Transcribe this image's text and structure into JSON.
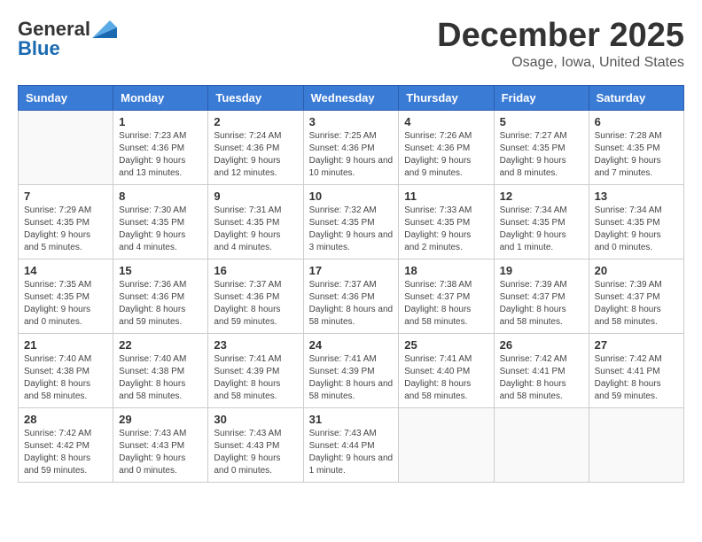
{
  "logo": {
    "general": "General",
    "blue": "Blue"
  },
  "header": {
    "month": "December 2025",
    "location": "Osage, Iowa, United States"
  },
  "days_of_week": [
    "Sunday",
    "Monday",
    "Tuesday",
    "Wednesday",
    "Thursday",
    "Friday",
    "Saturday"
  ],
  "weeks": [
    [
      {
        "day": "",
        "info": ""
      },
      {
        "day": "1",
        "info": "Sunrise: 7:23 AM\nSunset: 4:36 PM\nDaylight: 9 hours and 13 minutes."
      },
      {
        "day": "2",
        "info": "Sunrise: 7:24 AM\nSunset: 4:36 PM\nDaylight: 9 hours and 12 minutes."
      },
      {
        "day": "3",
        "info": "Sunrise: 7:25 AM\nSunset: 4:36 PM\nDaylight: 9 hours and 10 minutes."
      },
      {
        "day": "4",
        "info": "Sunrise: 7:26 AM\nSunset: 4:36 PM\nDaylight: 9 hours and 9 minutes."
      },
      {
        "day": "5",
        "info": "Sunrise: 7:27 AM\nSunset: 4:35 PM\nDaylight: 9 hours and 8 minutes."
      },
      {
        "day": "6",
        "info": "Sunrise: 7:28 AM\nSunset: 4:35 PM\nDaylight: 9 hours and 7 minutes."
      }
    ],
    [
      {
        "day": "7",
        "info": "Sunrise: 7:29 AM\nSunset: 4:35 PM\nDaylight: 9 hours and 5 minutes."
      },
      {
        "day": "8",
        "info": "Sunrise: 7:30 AM\nSunset: 4:35 PM\nDaylight: 9 hours and 4 minutes."
      },
      {
        "day": "9",
        "info": "Sunrise: 7:31 AM\nSunset: 4:35 PM\nDaylight: 9 hours and 4 minutes."
      },
      {
        "day": "10",
        "info": "Sunrise: 7:32 AM\nSunset: 4:35 PM\nDaylight: 9 hours and 3 minutes."
      },
      {
        "day": "11",
        "info": "Sunrise: 7:33 AM\nSunset: 4:35 PM\nDaylight: 9 hours and 2 minutes."
      },
      {
        "day": "12",
        "info": "Sunrise: 7:34 AM\nSunset: 4:35 PM\nDaylight: 9 hours and 1 minute."
      },
      {
        "day": "13",
        "info": "Sunrise: 7:34 AM\nSunset: 4:35 PM\nDaylight: 9 hours and 0 minutes."
      }
    ],
    [
      {
        "day": "14",
        "info": "Sunrise: 7:35 AM\nSunset: 4:35 PM\nDaylight: 9 hours and 0 minutes."
      },
      {
        "day": "15",
        "info": "Sunrise: 7:36 AM\nSunset: 4:36 PM\nDaylight: 8 hours and 59 minutes."
      },
      {
        "day": "16",
        "info": "Sunrise: 7:37 AM\nSunset: 4:36 PM\nDaylight: 8 hours and 59 minutes."
      },
      {
        "day": "17",
        "info": "Sunrise: 7:37 AM\nSunset: 4:36 PM\nDaylight: 8 hours and 58 minutes."
      },
      {
        "day": "18",
        "info": "Sunrise: 7:38 AM\nSunset: 4:37 PM\nDaylight: 8 hours and 58 minutes."
      },
      {
        "day": "19",
        "info": "Sunrise: 7:39 AM\nSunset: 4:37 PM\nDaylight: 8 hours and 58 minutes."
      },
      {
        "day": "20",
        "info": "Sunrise: 7:39 AM\nSunset: 4:37 PM\nDaylight: 8 hours and 58 minutes."
      }
    ],
    [
      {
        "day": "21",
        "info": "Sunrise: 7:40 AM\nSunset: 4:38 PM\nDaylight: 8 hours and 58 minutes."
      },
      {
        "day": "22",
        "info": "Sunrise: 7:40 AM\nSunset: 4:38 PM\nDaylight: 8 hours and 58 minutes."
      },
      {
        "day": "23",
        "info": "Sunrise: 7:41 AM\nSunset: 4:39 PM\nDaylight: 8 hours and 58 minutes."
      },
      {
        "day": "24",
        "info": "Sunrise: 7:41 AM\nSunset: 4:39 PM\nDaylight: 8 hours and 58 minutes."
      },
      {
        "day": "25",
        "info": "Sunrise: 7:41 AM\nSunset: 4:40 PM\nDaylight: 8 hours and 58 minutes."
      },
      {
        "day": "26",
        "info": "Sunrise: 7:42 AM\nSunset: 4:41 PM\nDaylight: 8 hours and 58 minutes."
      },
      {
        "day": "27",
        "info": "Sunrise: 7:42 AM\nSunset: 4:41 PM\nDaylight: 8 hours and 59 minutes."
      }
    ],
    [
      {
        "day": "28",
        "info": "Sunrise: 7:42 AM\nSunset: 4:42 PM\nDaylight: 8 hours and 59 minutes."
      },
      {
        "day": "29",
        "info": "Sunrise: 7:43 AM\nSunset: 4:43 PM\nDaylight: 9 hours and 0 minutes."
      },
      {
        "day": "30",
        "info": "Sunrise: 7:43 AM\nSunset: 4:43 PM\nDaylight: 9 hours and 0 minutes."
      },
      {
        "day": "31",
        "info": "Sunrise: 7:43 AM\nSunset: 4:44 PM\nDaylight: 9 hours and 1 minute."
      },
      {
        "day": "",
        "info": ""
      },
      {
        "day": "",
        "info": ""
      },
      {
        "day": "",
        "info": ""
      }
    ]
  ]
}
